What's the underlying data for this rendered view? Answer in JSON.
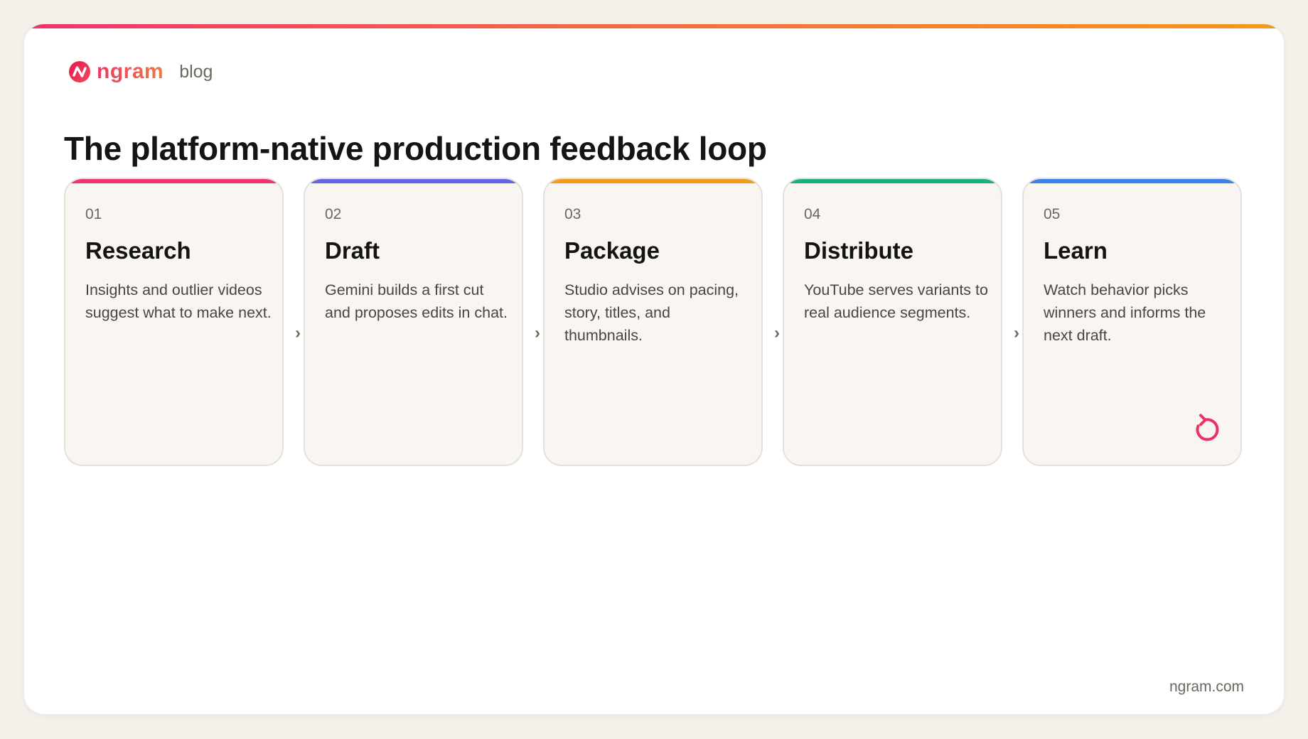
{
  "brand": {
    "name": "ngram",
    "section": "blog"
  },
  "page": {
    "title": "The platform-native production feedback loop"
  },
  "steps": [
    {
      "number": "01",
      "title": "Research",
      "description": "Insights and outlier videos suggest what to make next.",
      "color": "#f0336e"
    },
    {
      "number": "02",
      "title": "Draft",
      "description": "Gemini builds a first cut and proposes edits in chat.",
      "color": "#6366e8"
    },
    {
      "number": "03",
      "title": "Package",
      "description": "Studio advises on pacing, story, titles, and thumbnails.",
      "color": "#f39a1a"
    },
    {
      "number": "04",
      "title": "Distribute",
      "description": "YouTube serves variants to real audience segments.",
      "color": "#19b27d"
    },
    {
      "number": "05",
      "title": "Learn",
      "description": "Watch behavior picks winners and informs the next draft.",
      "color": "#3b82f0"
    }
  ],
  "connector": "›",
  "loop_icon": {
    "name": "loop-back-icon",
    "color": "#ee2f66"
  },
  "footer": {
    "url": "ngram.com"
  }
}
